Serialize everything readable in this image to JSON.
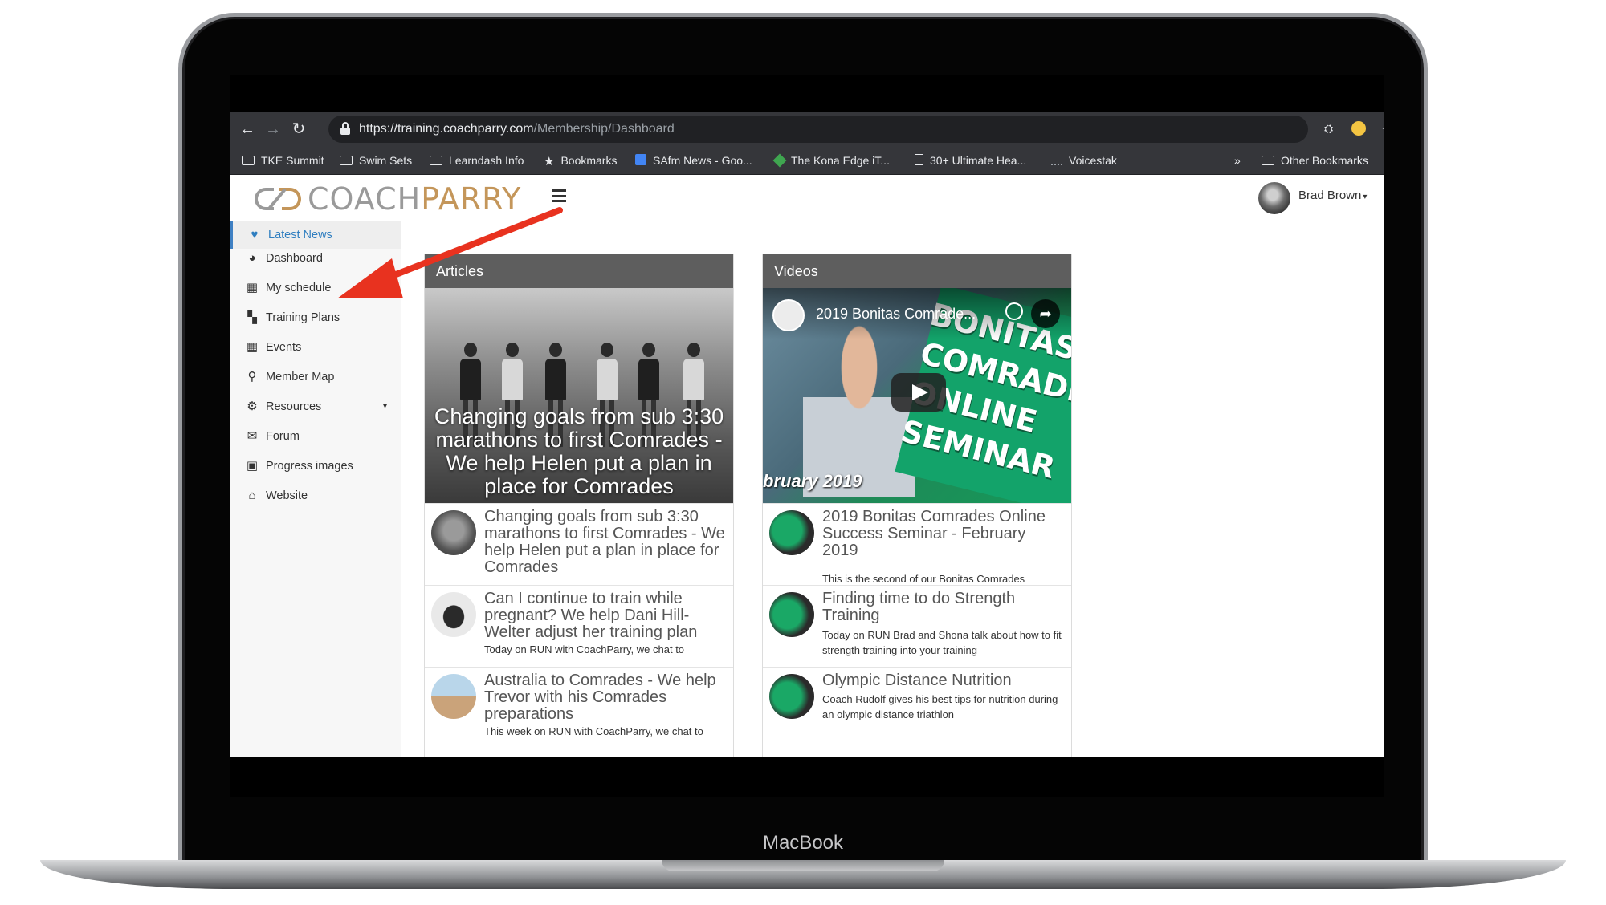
{
  "device": {
    "label": "MacBook"
  },
  "browser": {
    "url_host": "https://training.coachparry.com",
    "url_path": "/Membership/Dashboard",
    "back_icon": "arrow-left-icon",
    "forward_icon": "arrow-right-icon",
    "reload_icon": "reload-icon",
    "bookmark_star_icon": "star-icon",
    "bookmarks": [
      {
        "label": "TKE Summit",
        "icon": "folder-icon"
      },
      {
        "label": "Swim Sets",
        "icon": "folder-icon"
      },
      {
        "label": "Learndash Info",
        "icon": "folder-icon"
      },
      {
        "label": "Bookmarks",
        "icon": "star-icon"
      },
      {
        "label": "SAfm News - Goo...",
        "icon": "google-news-icon"
      },
      {
        "label": "The Kona Edge iT...",
        "icon": "kona-icon"
      },
      {
        "label": "30+ Ultimate Hea...",
        "icon": "document-icon"
      },
      {
        "label": "Voicestak",
        "icon": "dots-icon"
      }
    ],
    "overflow_label": "»",
    "other_bookmarks": "Other Bookmarks"
  },
  "header": {
    "logo_coach": "COACH",
    "logo_parry": "PARRY",
    "user_name": "Brad Brown",
    "user_caret": "▾"
  },
  "sidebar": {
    "items": [
      {
        "label": "Latest News",
        "icon": "heart-pulse-icon",
        "glyph": "♥"
      },
      {
        "label": "Dashboard",
        "icon": "dashboard-icon",
        "glyph": "◕"
      },
      {
        "label": "My schedule",
        "icon": "calendar-icon",
        "glyph": "▦"
      },
      {
        "label": "Training Plans",
        "icon": "grid-icon",
        "glyph": "▚"
      },
      {
        "label": "Events",
        "icon": "calendar-icon",
        "glyph": "▦"
      },
      {
        "label": "Member Map",
        "icon": "map-pin-icon",
        "glyph": "⚲"
      },
      {
        "label": "Resources",
        "icon": "cogs-icon",
        "glyph": "⚙",
        "caret": "▾"
      },
      {
        "label": "Forum",
        "icon": "comments-icon",
        "glyph": "✉"
      },
      {
        "label": "Progress images",
        "icon": "image-icon",
        "glyph": "▣"
      },
      {
        "label": "Website",
        "icon": "home-icon",
        "glyph": "⌂"
      }
    ]
  },
  "articles": {
    "heading": "Articles",
    "hero_caption": "Changing goals from sub 3:30 marathons to first Comrades - We help Helen put a plan in place for Comrades",
    "items": [
      {
        "title": "Changing goals from sub 3:30 marathons to first Comrades - We help Helen put a plan in place for Comrades",
        "desc": ""
      },
      {
        "title": "Can I continue to train while pregnant? We help Dani Hill-Welter adjust her training plan",
        "desc": "Today on RUN with CoachParry, we chat to"
      },
      {
        "title": "Australia to Comrades - We help Trevor with his Comrades preparations",
        "desc": "This week on RUN with CoachParry, we chat to"
      }
    ]
  },
  "videos": {
    "heading": "Videos",
    "hero_title": "2019 Bonitas Comrade...",
    "hero_banner": "BONITAS COMRADES ONLINE SEMINAR",
    "hero_date": "bruary 2019",
    "items": [
      {
        "title": "2019 Bonitas Comrades Online Success Seminar - February 2019",
        "desc": "This is the second of our Bonitas Comrades"
      },
      {
        "title": "Finding time to do Strength Training",
        "desc": "Today on RUN Brad and Shona talk about how to fit strength training into your training"
      },
      {
        "title": "Olympic Distance Nutrition",
        "desc": "Coach Rudolf gives his best tips for nutrition during an olympic distance triathlon"
      }
    ]
  }
}
